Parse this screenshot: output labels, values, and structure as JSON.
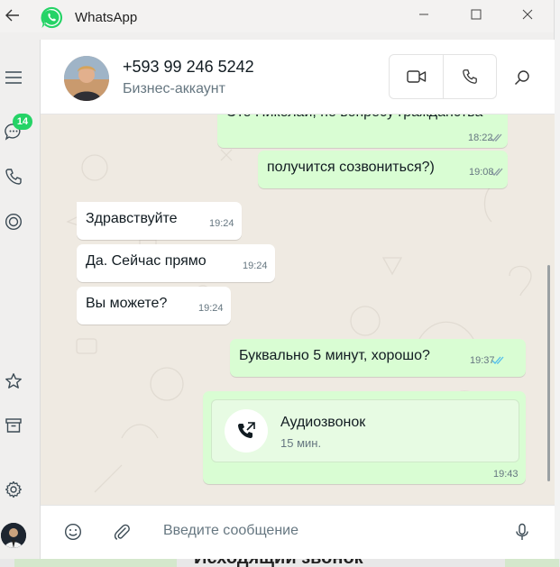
{
  "titlebar": {
    "app_title": "WhatsApp",
    "icons": [
      "back-arrow-icon",
      "whatsapp-logo-icon",
      "minimize-icon",
      "maximize-icon",
      "close-icon"
    ]
  },
  "rail": {
    "unread_badge": "14",
    "icons": [
      "menu-icon",
      "chats-icon",
      "calls-icon",
      "status-icon",
      "starred-icon",
      "archive-icon",
      "settings-icon",
      "profile-avatar"
    ]
  },
  "header": {
    "contact_name": "+593 99 246 5242",
    "contact_subtitle": "Бизнес-аккаунт"
  },
  "messages": [
    {
      "dir": "out",
      "text": "Это Николай, по вопросу гражданства",
      "time": "18:22",
      "status": "read-grey"
    },
    {
      "dir": "out",
      "text": "получится созвониться?)",
      "time": "19:08",
      "status": "read-grey"
    },
    {
      "dir": "in",
      "text": "Здравствуйте",
      "time": "19:24"
    },
    {
      "dir": "in",
      "text": "Да. Сейчас прямо",
      "time": "19:24"
    },
    {
      "dir": "in",
      "text": "Вы можете?",
      "time": "19:24"
    },
    {
      "dir": "out",
      "text": "Буквально 5 минут, хорошо?",
      "time": "19:37",
      "status": "read-blue"
    }
  ],
  "call_message": {
    "title": "Аудиозвонок",
    "duration": "15 мин.",
    "time": "19:43"
  },
  "composer": {
    "placeholder": "Введите сообщение"
  },
  "background_window": {
    "text": "Исходящий звонок"
  },
  "colors": {
    "outgoing_bubble": "#d9fdd3",
    "incoming_bubble": "#ffffff",
    "chat_background": "#efeae2",
    "badge_green": "#25d366",
    "read_tick_blue": "#53bdeb"
  }
}
